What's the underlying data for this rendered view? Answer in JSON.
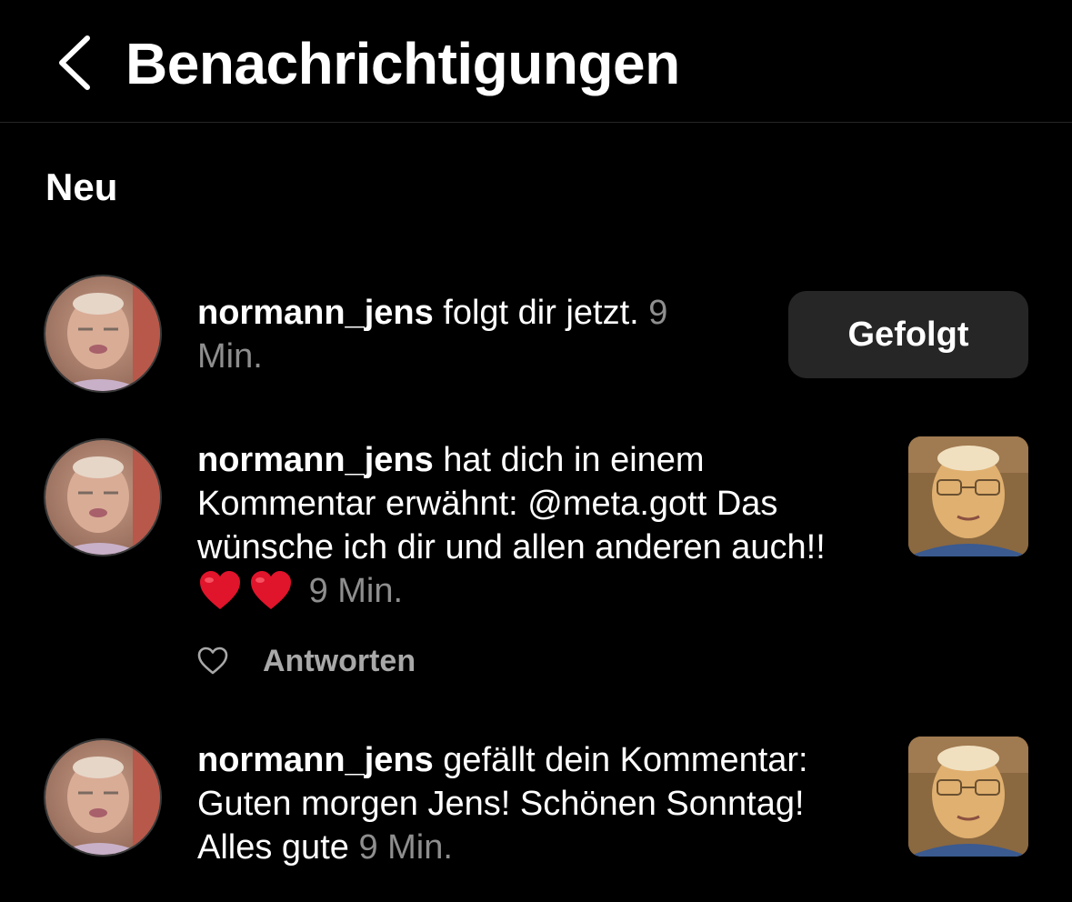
{
  "header": {
    "title": "Benachrichtigungen",
    "back_icon": "chevron-left-icon"
  },
  "sections": [
    {
      "label": "Neu",
      "notifications": [
        {
          "username": "normann_jens",
          "text": " folgt dir jetzt.",
          "time": "9 Min.",
          "button_label": "Gefolgt"
        },
        {
          "username": "normann_jens",
          "text": " hat dich in einem Kommentar erwähnt: @meta.gott Das wünsche ich dir und allen anderen auch!!",
          "emoji": [
            "red-heart-icon",
            "red-heart-icon"
          ],
          "time": "9 Min.",
          "like_icon": "heart-outline-icon",
          "reply_label": "Antworten"
        },
        {
          "username": "normann_jens",
          "text": " gefällt dein Kommentar: Guten morgen Jens! Schönen Sonntag! Alles gute",
          "time": "9 Min."
        }
      ]
    }
  ],
  "colors": {
    "background": "#000000",
    "text": "#ffffff",
    "muted": "#8e8e8e",
    "button_bg": "#262626",
    "heart": "#e0142b"
  }
}
